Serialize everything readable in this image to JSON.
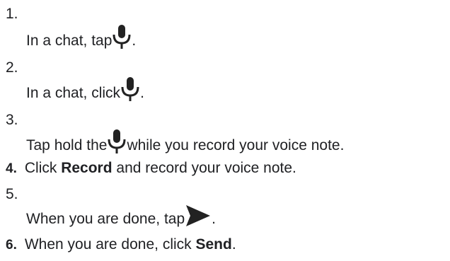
{
  "steps": [
    {
      "num": "1.",
      "before": "In a chat, tap ",
      "icon": "microphone-icon",
      "after": "."
    },
    {
      "num": "2.",
      "before": "In a chat, click ",
      "icon": "microphone-icon",
      "after": "."
    },
    {
      "num": "3.",
      "before": "Tap hold the ",
      "icon": "microphone-icon",
      "after": " while you record your voice note."
    },
    {
      "num": "4.",
      "before": "Click ",
      "bold": "Record",
      "after": " and record your voice note."
    },
    {
      "num": "5.",
      "before": "When you are done, tap ",
      "icon": "send-icon",
      "after": "."
    },
    {
      "num": "6.",
      "before": "When you are done, click ",
      "bold": "Send",
      "after": "."
    }
  ],
  "colors": {
    "text": "#202124",
    "icon": "#222222"
  }
}
